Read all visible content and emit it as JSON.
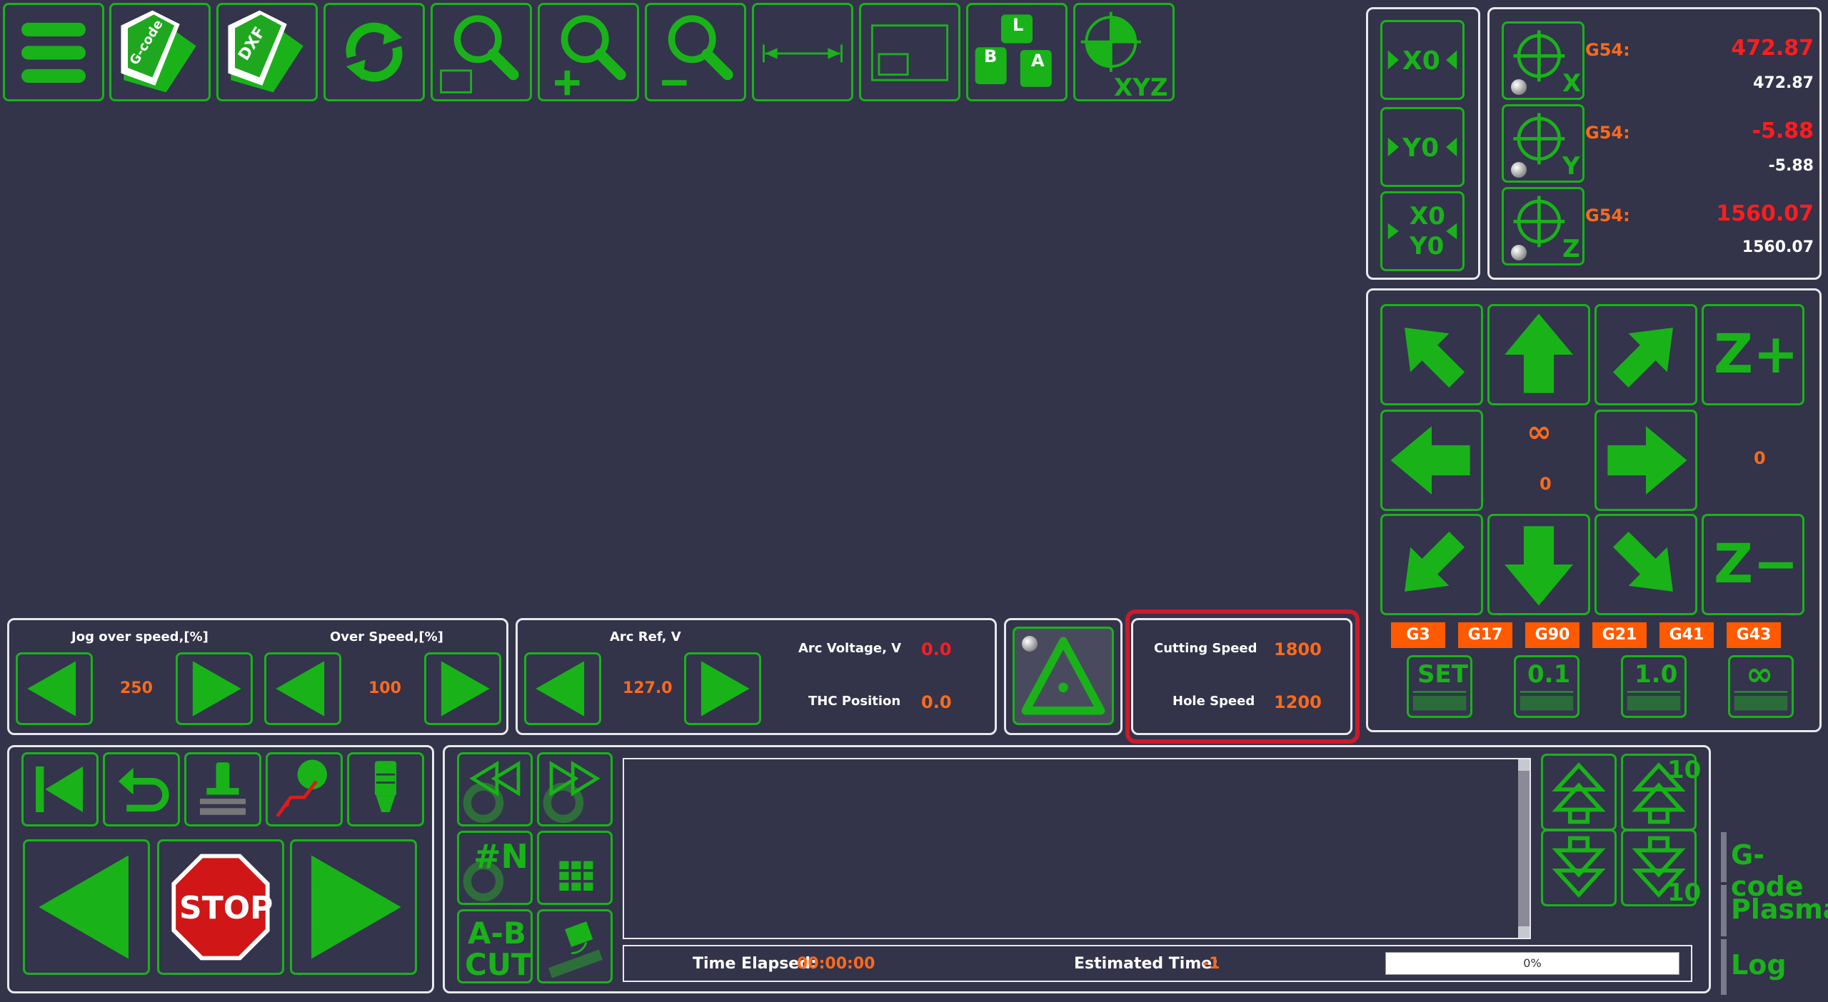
{
  "colors": {
    "accent": "#19b319",
    "value": "#ff6a1a",
    "alert": "#ff1d1d",
    "highlight": "#cc1a2a"
  },
  "toolbar": {
    "gcode_icon_text": "G-code",
    "dxf_icon_text": "DXF",
    "bal_keys": [
      "B",
      "A",
      "L"
    ],
    "xyz_text": "XYZ"
  },
  "zero": {
    "x": "X0",
    "y": "Y0",
    "xy1": "X0",
    "xy2": "Y0"
  },
  "dro": {
    "axis_letters": [
      "X",
      "Y",
      "Z"
    ],
    "x": {
      "cs": "G54:",
      "machine": "472.87",
      "work": "472.87"
    },
    "y": {
      "cs": "G54:",
      "machine": "-5.88",
      "work": "-5.88"
    },
    "z": {
      "cs": "G54:",
      "machine": "1560.07",
      "work": "1560.07"
    }
  },
  "jog": {
    "zplus": "Z+",
    "zminus": "Z−",
    "infinity": "∞",
    "step_value": "0",
    "z_value": "0",
    "gcodes": [
      "G3",
      "G17",
      "G90",
      "G21",
      "G41",
      "G43"
    ],
    "step_set": "SET",
    "step_01": "0.1",
    "step_10": "1.0",
    "step_inf": "∞"
  },
  "speed": {
    "jog_label": "Jog over speed,[%]",
    "jog_value": "250",
    "over_label": "Over Speed,[%]",
    "over_value": "100"
  },
  "arc": {
    "ref_label": "Arc Ref, V",
    "ref_value": "127.0",
    "voltage_label": "Arc Voltage, V",
    "voltage_value": "0.0",
    "thc_label": "THC Position",
    "thc_value": "0.0"
  },
  "cut": {
    "cutting_label": "Cutting Speed",
    "cutting_value": "1800",
    "hole_label": "Hole Speed",
    "hole_value": "1200"
  },
  "controls": {
    "stop_label": "STOP",
    "n_label": "#N",
    "ab_line1": "A-B",
    "ab_line2": "CUT"
  },
  "program": {
    "time_elapsed_label": "Time Elapsed:",
    "time_elapsed_value": "00:00:00",
    "estimated_label": "Estimated Time:",
    "estimated_value": "-1",
    "progress": 0,
    "progress_text": "0%",
    "scroll_up_10": "10",
    "scroll_down_10": "10"
  },
  "tabs": [
    "G-code",
    "Plasma",
    "Log"
  ]
}
